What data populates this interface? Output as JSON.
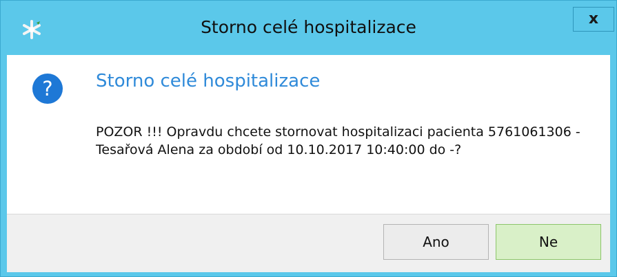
{
  "window": {
    "title": "Storno celé hospitalizace",
    "close_label": "x",
    "app_icon": "star-icon"
  },
  "dialog": {
    "icon": "question-icon",
    "icon_glyph": "?",
    "instruction": "Storno celé hospitalizace",
    "message": "POZOR !!! Opravdu chcete stornovat hospitalizaci pacienta 5761061306 - Tesařová Alena za období od 10.10.2017 10:40:00 do -?"
  },
  "buttons": {
    "yes_label": "Ano",
    "no_label": "Ne"
  },
  "colors": {
    "titlebar": "#5bc8ea",
    "instruction_text": "#2f8ad9",
    "question_icon": "#1e78d6",
    "default_button": "#d9f0c8"
  }
}
